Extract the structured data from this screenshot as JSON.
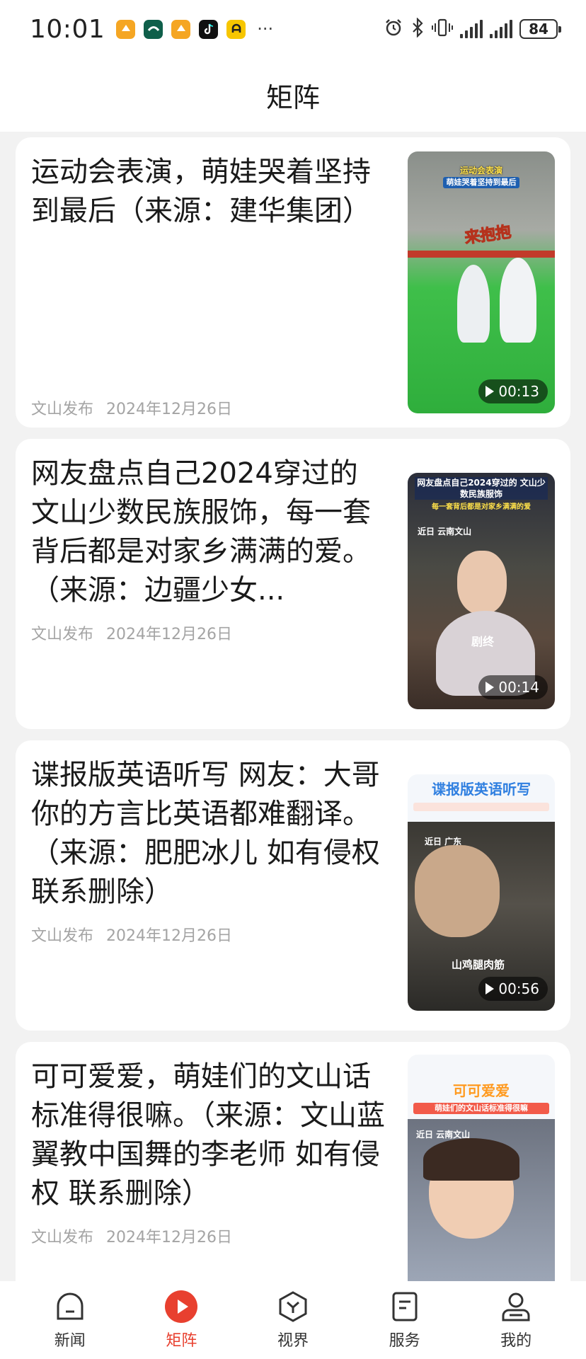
{
  "status_bar": {
    "time": "10:01",
    "battery": "84",
    "more": "···",
    "app_icons": [
      {
        "name": "app-icon-orange-1",
        "glyph": "◈",
        "color": "#f5a623"
      },
      {
        "name": "app-icon-green",
        "glyph": "◣",
        "color": "#0f5f4a"
      },
      {
        "name": "app-icon-orange-2",
        "glyph": "◈",
        "color": "#f5a623"
      },
      {
        "name": "tiktok-icon",
        "glyph": "♪",
        "color": "#111111"
      },
      {
        "name": "app-icon-yellow",
        "glyph": "A",
        "color": "#f7c600"
      }
    ]
  },
  "header": {
    "title": "矩阵"
  },
  "feed": [
    {
      "title": "运动会表演，萌娃哭着坚持到最后（来源：建华集团）",
      "source": "文山发布",
      "date": "2024年12月26日",
      "duration": "00:13",
      "thumb_caption": "运动会表演",
      "thumb_subcaption": "萌娃哭着坚持到最后",
      "thumb_sticker": "来抱抱"
    },
    {
      "title": "网友盘点自己2024穿过的文山少数民族服饰，每一套背后都是对家乡满满的爱。（来源：边疆少女...",
      "source": "文山发布",
      "date": "2024年12月26日",
      "duration": "00:14",
      "thumb_caption": "网友盘点自己2024穿过的 文山少数民族服饰",
      "thumb_subcaption": "每一套背后都是对家乡满满的爱",
      "thumb_tag": "近日 云南文山",
      "thumb_sticker": "剧终"
    },
    {
      "title": "谍报版英语听写 网友：大哥 你的方言比英语都难翻译。（来源：肥肥冰儿 如有侵权 联系删除）",
      "source": "文山发布",
      "date": "2024年12月26日",
      "duration": "00:56",
      "thumb_caption": "谍报版英语听写",
      "thumb_tag": "近日 广东",
      "thumb_sticker": "山鸡腿肉筋"
    },
    {
      "title": "可可爱爱，萌娃们的文山话标准得很嘛。（来源：文山蓝翼教中国舞的李老师 如有侵权 联系删除）",
      "source": "文山发布",
      "date": "2024年12月26日",
      "thumb_caption": "可可爱爱",
      "thumb_subcaption": "萌娃们的文山话标准得很嘛",
      "thumb_tag": "近日 云南文山"
    }
  ],
  "nav": [
    {
      "label": "新闻",
      "icon": "news-icon",
      "active": false
    },
    {
      "label": "矩阵",
      "icon": "play-circle-icon",
      "active": true
    },
    {
      "label": "视界",
      "icon": "vision-hexagon-icon",
      "active": false
    },
    {
      "label": "服务",
      "icon": "service-document-icon",
      "active": false
    },
    {
      "label": "我的",
      "icon": "profile-icon",
      "active": false
    }
  ],
  "colors": {
    "accent": "#e8402f",
    "meta_text": "#a4a4a4",
    "background": "#f2f2f2"
  }
}
